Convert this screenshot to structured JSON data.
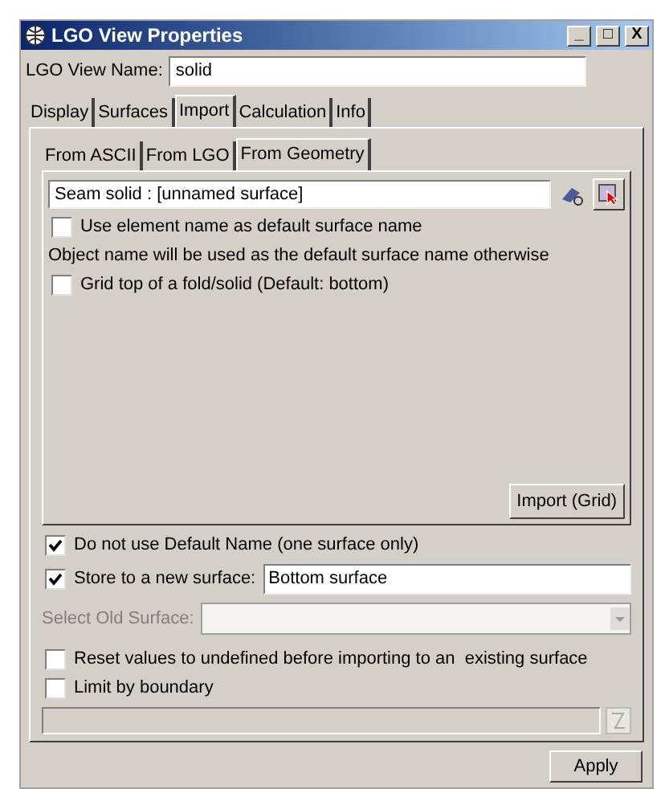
{
  "window": {
    "title": "LGO View Properties",
    "controls": [
      "_",
      "□",
      "X"
    ]
  },
  "view_name": {
    "label": "LGO View Name:",
    "value": "solid"
  },
  "tabs": [
    {
      "label": "Display",
      "selected": false
    },
    {
      "label": "Surfaces",
      "selected": false
    },
    {
      "label": "Import",
      "selected": true
    },
    {
      "label": "Calculation",
      "selected": false
    },
    {
      "label": "Info",
      "selected": false
    }
  ],
  "subtabs": [
    {
      "label": "From ASCII",
      "selected": false
    },
    {
      "label": "From LGO",
      "selected": false
    },
    {
      "label": "From Geometry",
      "selected": true
    }
  ],
  "geometry": {
    "field_value": "Seam solid : [unnamed surface]",
    "options": [
      {
        "kind": "checkbox",
        "label": "Use element name as default surface name",
        "checked": false
      },
      {
        "kind": "note",
        "label": "Object name will be used as the default surface name otherwise"
      },
      {
        "kind": "checkbox",
        "label": "Grid top of a fold/solid (Default: bottom)",
        "checked": false
      }
    ],
    "button": "Import (Grid)"
  },
  "do_not_use_default": {
    "label": "Do not use Default Name (one surface only)",
    "checked": true
  },
  "store_new": {
    "label": "Store to a new surface:",
    "checked": true,
    "value": "Bottom surface"
  },
  "select_old": {
    "label": "Select Old Surface:",
    "disabled": true
  },
  "reset_values": {
    "label": "Reset values to undefined before importing to an  existing surface",
    "checked": false
  },
  "limit_boundary": {
    "label": "Limit by boundary",
    "checked": false
  },
  "apply_button": "Apply"
}
